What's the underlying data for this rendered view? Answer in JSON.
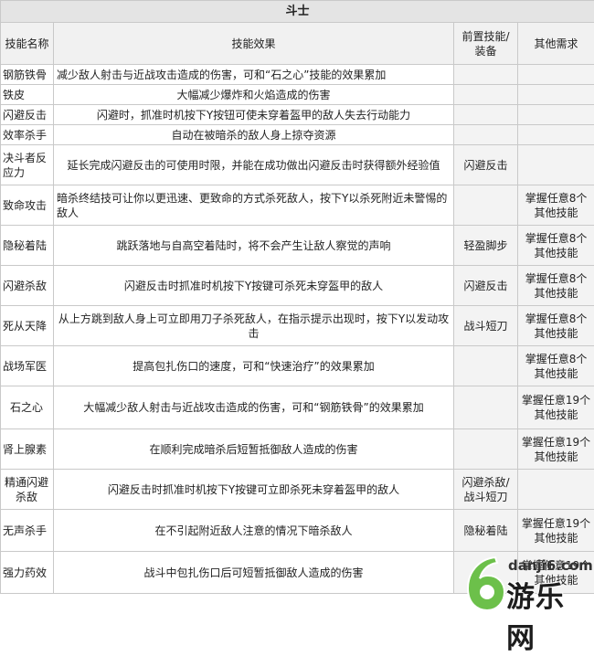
{
  "title": "斗士",
  "headers": {
    "name": "技能名称",
    "effect": "技能效果",
    "prereq": "前置技能/装备",
    "other": "其他需求"
  },
  "rows": [
    {
      "name": "钢筋铁骨",
      "effect": "减少敌人射击与近战攻击造成的伤害，可和“石之心”技能的效果累加",
      "prereq": "",
      "other": ""
    },
    {
      "name": "铁皮",
      "effect": "大幅减少爆炸和火焰造成的伤害",
      "prereq": "",
      "other": ""
    },
    {
      "name": "闪避反击",
      "effect": "闪避时，抓准时机按下Y按钮可使未穿着盔甲的敌人失去行动能力",
      "prereq": "",
      "other": ""
    },
    {
      "name": "效率杀手",
      "effect": "自动在被暗杀的敌人身上掠夺资源",
      "prereq": "",
      "other": ""
    },
    {
      "name": "决斗者反应力",
      "effect": "延长完成闪避反击的可使用时限，并能在成功做出闪避反击时获得额外经验值",
      "prereq": "闪避反击",
      "other": ""
    },
    {
      "name": "致命攻击",
      "effect": "暗杀终结技可让你以更迅速、更致命的方式杀死敌人，按下Y以杀死附近未警惕的敌人",
      "prereq": "",
      "other": "掌握任意8个其他技能"
    },
    {
      "name": "隐秘着陆",
      "effect": "跳跃落地与自高空着陆时，将不会产生让敌人察觉的声响",
      "prereq": "轻盈脚步",
      "other": "掌握任意8个其他技能"
    },
    {
      "name": "闪避杀敌",
      "effect": "闪避反击时抓准时机按下Y按键可杀死未穿盔甲的敌人",
      "prereq": "闪避反击",
      "other": "掌握任意8个其他技能"
    },
    {
      "name": "死从天降",
      "effect": "从上方跳到敌人身上可立即用刀子杀死敌人，在指示提示出现时，按下Y以发动攻击",
      "prereq": "战斗短刀",
      "other": "掌握任意8个其他技能"
    },
    {
      "name": "战场军医",
      "effect": "提高包扎伤口的速度，可和“快速治疗”的效果累加",
      "prereq": "",
      "other": "掌握任意8个其他技能"
    },
    {
      "name": "石之心",
      "effect": "大幅减少敌人射击与近战攻击造成的伤害，可和“钢筋铁骨”的效果累加",
      "prereq": "",
      "other": "掌握任意19个其他技能"
    },
    {
      "name": "肾上腺素",
      "effect": "在顺利完成暗杀后短暂抵御敌人造成的伤害",
      "prereq": "",
      "other": "掌握任意19个其他技能"
    },
    {
      "name": "精通闪避杀敌",
      "effect": "闪避反击时抓准时机按下Y按键可立即杀死未穿着盔甲的敌人",
      "prereq": "闪避杀敌/战斗短刀",
      "other": ""
    },
    {
      "name": "无声杀手",
      "effect": "在不引起附近敌人注意的情况下暗杀敌人",
      "prereq": "隐秘着陆",
      "other": "掌握任意19个其他技能"
    },
    {
      "name": "强力药效",
      "effect": "战斗中包扎伤口后可短暂抵御敌人造成的伤害",
      "prereq": "",
      "other": "掌握任意19个其他技能"
    }
  ],
  "watermark": {
    "url": "danji6.com",
    "name": "游乐网",
    "logo": "6"
  },
  "colors": {
    "border": "#c9c9c9",
    "title_bg": "#e4e4e4",
    "logo_green": "#6cc04a"
  }
}
